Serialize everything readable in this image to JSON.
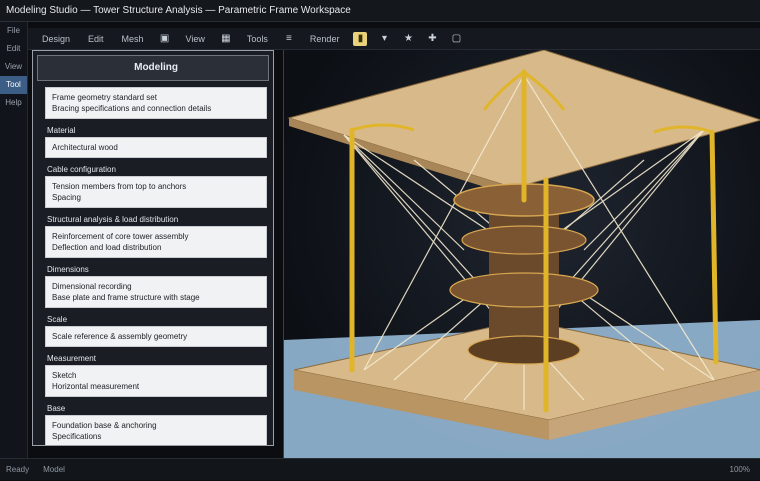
{
  "window": {
    "title": "Modeling Studio — Tower Structure Analysis — Parametric Frame Workspace"
  },
  "left_rail": {
    "items": [
      "File",
      "Edit",
      "View",
      "Tool",
      "Help"
    ]
  },
  "toolbar": {
    "items": [
      "Design",
      "Edit",
      "Mesh",
      "View",
      "Tools",
      "Render"
    ],
    "icons": [
      "display-icon",
      "grid-icon",
      "layers-icon",
      "cursor-icon",
      "brush-icon",
      "move-icon",
      "pin-icon",
      "select-icon"
    ]
  },
  "panel": {
    "header": "Modeling",
    "sections": [
      {
        "title": "",
        "lines": [
          "Frame geometry standard set",
          "Bracing specifications and connection details"
        ]
      },
      {
        "title": "Material",
        "lines": [
          "Architectural wood"
        ]
      },
      {
        "title": "Cable configuration",
        "lines": [
          "Tension members from top to anchors",
          "Spacing"
        ]
      },
      {
        "title": "Structural analysis & load distribution",
        "lines": [
          "Reinforcement of core tower assembly",
          "Deflection and load distribution"
        ]
      },
      {
        "title": "Dimensions",
        "lines": [
          "Dimensional recording",
          "Base plate and frame structure with stage"
        ]
      },
      {
        "title": "Scale",
        "lines": [
          "Scale reference & assembly geometry"
        ]
      },
      {
        "title": "Measurement",
        "lines": [
          "Sketch",
          "Horizontal measurement"
        ]
      },
      {
        "title": "Base",
        "lines": [
          "Foundation base & anchoring",
          "Specifications"
        ]
      }
    ]
  },
  "status": {
    "left": "Ready",
    "mid": "Model",
    "right": "100%"
  },
  "colors": {
    "frame_gold": "#e1b52a",
    "wood": "#d8b98a",
    "cable": "#f4ead0",
    "floor": "#9ec3e2"
  }
}
